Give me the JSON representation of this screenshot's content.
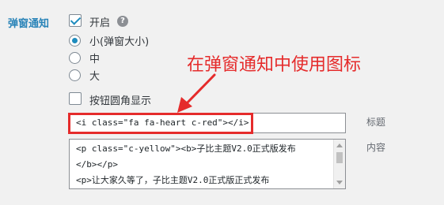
{
  "section": {
    "label": "弹窗通知"
  },
  "enable": {
    "label": "开启",
    "checked": true,
    "help_icon": "question-circle-icon"
  },
  "size_options": [
    {
      "label": "小(弹窗大小)",
      "selected": true
    },
    {
      "label": "中",
      "selected": false
    },
    {
      "label": "大",
      "selected": false
    }
  ],
  "round_buttons": {
    "label": "按钮圆角显示",
    "checked": false
  },
  "annotation": {
    "text": "在弹窗通知中使用图标",
    "color": "#e52b2b"
  },
  "title_field": {
    "value": "<i class=\"fa fa-heart c-red\"></i>",
    "label": "标题"
  },
  "content_field": {
    "lines": [
      "<p class=\"c-yellow\"><b>子比主题V2.0正式版发布",
      "</b></p>",
      "<p>让大家久等了，子比主题V2.0正式版正式发布"
    ],
    "label": "内容"
  },
  "colors": {
    "accent": "#1e8cbe",
    "section_label": "#2a84b8",
    "background": "#f1f1f1"
  }
}
